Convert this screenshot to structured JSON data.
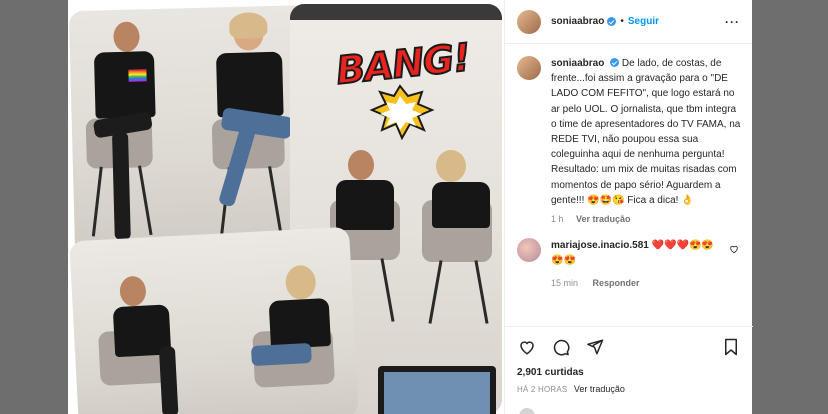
{
  "post": {
    "username": "soniaabrao",
    "follow_label": "Seguir",
    "caption_username": "soniaabrao",
    "caption": "De lado, de costas, de frente...foi assim a gravação para o \"DE LADO COM FEFITO\", que logo estará no ar pelo UOL. O jornalista, que tbm integra o time de apresentadores do TV FAMA, na REDE TVI, não poupou essa sua coleguinha aqui de nenhuma pergunta! Resultado: um mix de muitas risadas com momentos de papo sério! Aguardem a gente!!! 😍🤩😘 Fica a dica! 👌",
    "caption_time": "1 h",
    "caption_translate": "Ver tradução",
    "comment_username": "mariajose.inacio.581",
    "comment_text": "❤️❤️❤️😍😍😍😍",
    "comment_time": "15 min",
    "comment_reply": "Responder",
    "likes": "2,901 curtidas",
    "posted_ago": "HÁ 2 HORAS",
    "posted_translate": "Ver tradução"
  },
  "media": {
    "sticker_text": "BANG!"
  },
  "icons": {
    "more": "more-icon",
    "like": "heart-icon",
    "comment": "comment-icon",
    "share": "share-icon",
    "save": "bookmark-icon",
    "comment_like": "heart-icon-small"
  },
  "colors": {
    "link": "#0095f6",
    "verified": "#3897f0",
    "muted": "#8e8e8e",
    "text": "#262626"
  }
}
